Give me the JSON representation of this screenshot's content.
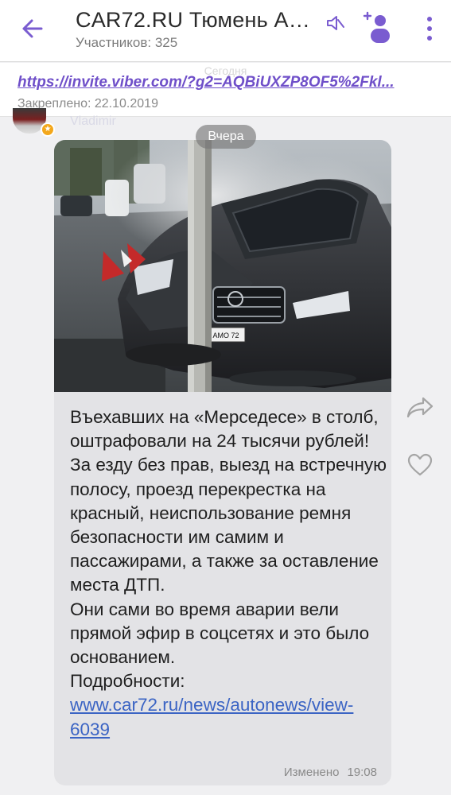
{
  "header": {
    "title": "CAR72.RU Тюмень Ав...",
    "subtitle": "Участников: 325"
  },
  "pinned": {
    "faint_text": "Сегодня",
    "link": "https://invite.viber.com/?g2=AQBiUXZP8OF5%2Fkl...",
    "date": "Закреплено: 22.10.2019"
  },
  "sender": {
    "name": "Vladimir",
    "badge_icon": "star-icon"
  },
  "date_separator": "Вчера",
  "message": {
    "text": "Въехавших на «Мерседесе» в столб, оштрафовали на 24 тысячи рублей!\nЗа езду без прав, выезд на встречную полосу, проезд перекрестка на красный, неиспользование ремня безопасности им самим и пассажирами, а также за оставление места ДТП.\nОни сами во время аварии вели прямой эфир в соцсетях и это было основанием.\nПодробности: ",
    "link_text": "www.car72.ru/news/autonews/view-6039",
    "edited_label": "Изменено",
    "time": "19:08",
    "plate_text": "АМО 72"
  },
  "colors": {
    "accent": "#7a5cd0",
    "link": "#3b64c4",
    "bubble": "#e3e3e6",
    "background": "#f0f0f2"
  },
  "icons": {
    "back": "arrow-left-icon",
    "mute": "bell-off-icon",
    "add_member": "add-user-icon",
    "menu": "more-vertical-icon",
    "forward": "forward-icon",
    "like": "heart-icon"
  }
}
